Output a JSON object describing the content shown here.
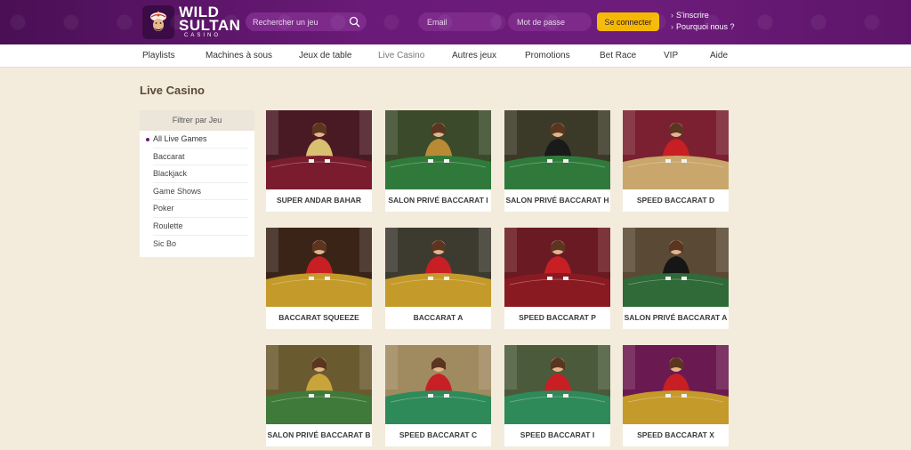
{
  "brand": {
    "name_line1": "WILD",
    "name_line2": "SULTAN",
    "tagline": "CASINO"
  },
  "header": {
    "search_placeholder": "Rechercher un jeu",
    "email_placeholder": "Email",
    "password_placeholder": "Mot de passe",
    "login_label": "Se connecter",
    "register_label": "S'inscrire",
    "why_us_label": "Pourquoi nous ?"
  },
  "nav": {
    "items": [
      "Playlists",
      "Machines à sous",
      "Jeux de table",
      "Live Casino",
      "Autres jeux",
      "Promotions",
      "Bet Race",
      "VIP",
      "Aide"
    ],
    "active": "Live Casino"
  },
  "page": {
    "title": "Live Casino"
  },
  "filter": {
    "heading": "Filtrer par Jeu",
    "items": [
      "All Live Games",
      "Baccarat",
      "Blackjack",
      "Game Shows",
      "Poker",
      "Roulette",
      "Sic Bo"
    ],
    "active": "All Live Games"
  },
  "games": [
    {
      "title": "SUPER ANDAR BAHAR",
      "table": "#7a1b2e",
      "bg": "#4a1a24",
      "dealer": "#d8c070"
    },
    {
      "title": "SALON PRIVÉ BACCARAT I",
      "table": "#2f7a3a",
      "bg": "#3b4a2a",
      "dealer": "#b88a35"
    },
    {
      "title": "SALON PRIVÉ BACCARAT H",
      "table": "#2f7a3a",
      "bg": "#3b3a28",
      "dealer": "#1a1a1a"
    },
    {
      "title": "SPEED BACCARAT D",
      "table": "#c9a66b",
      "bg": "#7a2030",
      "dealer": "#c71f24"
    },
    {
      "title": "BACCARAT SQUEEZE",
      "table": "#c49a2a",
      "bg": "#3a2418",
      "dealer": "#c71f24"
    },
    {
      "title": "BACCARAT A",
      "table": "#c49a2a",
      "bg": "#3d3a30",
      "dealer": "#c71f24"
    },
    {
      "title": "SPEED BACCARAT P",
      "table": "#8a1a22",
      "bg": "#6a1a22",
      "dealer": "#c71f24"
    },
    {
      "title": "SALON PRIVÉ BACCARAT A",
      "table": "#2f6a38",
      "bg": "#5a4a35",
      "dealer": "#161616"
    },
    {
      "title": "SALON PRIVÉ BACCARAT B",
      "table": "#3f7a3a",
      "bg": "#6a5a30",
      "dealer": "#c9a43a"
    },
    {
      "title": "SPEED BACCARAT C",
      "table": "#2f8a5a",
      "bg": "#a08a60",
      "dealer": "#c71f24"
    },
    {
      "title": "SPEED BACCARAT I",
      "table": "#2f8a5a",
      "bg": "#4a5a3a",
      "dealer": "#c71f24"
    },
    {
      "title": "SPEED BACCARAT X",
      "table": "#c49a2a",
      "bg": "#6a1a50",
      "dealer": "#c71f24"
    }
  ]
}
